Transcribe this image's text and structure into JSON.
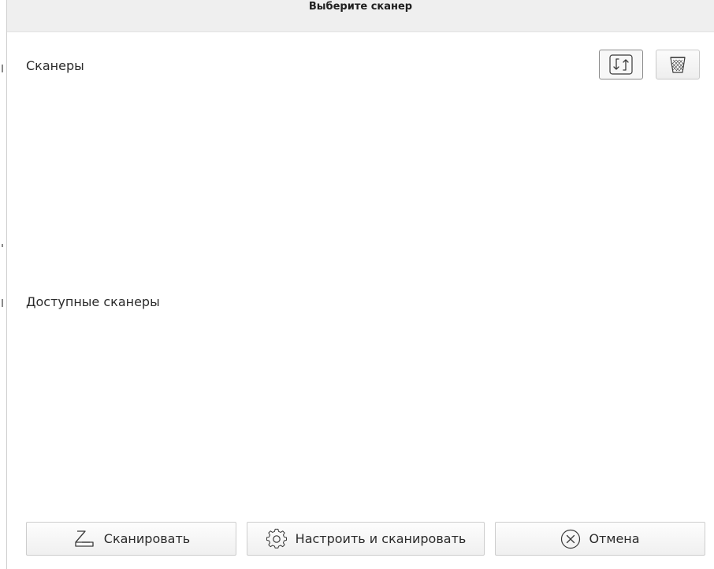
{
  "window": {
    "title": "Выберите сканер"
  },
  "toolbar": {
    "refresh_icon": "refresh-arrows-icon",
    "delete_icon": "trash-bin-icon"
  },
  "sections": {
    "scanners_label": "Сканеры",
    "available_label": "Доступные сканеры",
    "scanners_items": [],
    "available_items": []
  },
  "buttons": {
    "scan_label": "Сканировать",
    "scan_icon": "scanner-icon",
    "configure_label": "Настроить и сканировать",
    "configure_icon": "gear-icon",
    "cancel_label": "Отмена",
    "cancel_icon": "circle-x-icon"
  },
  "colors": {
    "title_bar_bg": "#efefef",
    "button_border": "#cdcdcd",
    "text": "#2b2b2b"
  }
}
